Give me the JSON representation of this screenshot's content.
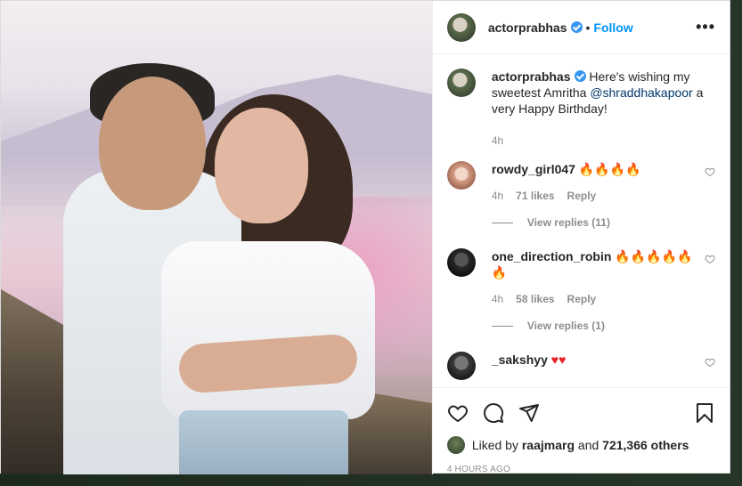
{
  "post": {
    "author": "actorprabhas",
    "follow_label": "Follow",
    "separator": "•",
    "more_label": "•••"
  },
  "caption": {
    "user": "actorprabhas",
    "text_before": "Here's wishing my sweetest Amritha ",
    "mention": "@shraddhakapoor",
    "text_after": " a very Happy Birthday!",
    "time": "4h"
  },
  "comments": [
    {
      "user": "rowdy_girl047",
      "text": "🔥🔥🔥🔥",
      "time": "4h",
      "likes": "71 likes",
      "reply_label": "Reply",
      "view_replies": "View replies (11)"
    },
    {
      "user": "one_direction_robin",
      "text": "🔥🔥🔥🔥🔥🔥",
      "time": "4h",
      "likes": "58 likes",
      "reply_label": "Reply",
      "view_replies": "View replies (1)"
    },
    {
      "user": "_sakshyy",
      "text": "♥♥"
    }
  ],
  "likes": {
    "prefix": "Liked by",
    "user": "raajmarg",
    "conjunction": "and",
    "others": "721,366 others"
  },
  "timestamp": "4 HOURS AGO",
  "colors": {
    "accent": "#0095f6",
    "verified": "#3897f0",
    "fire": "#e8590c",
    "heart": "#ed1c24"
  }
}
